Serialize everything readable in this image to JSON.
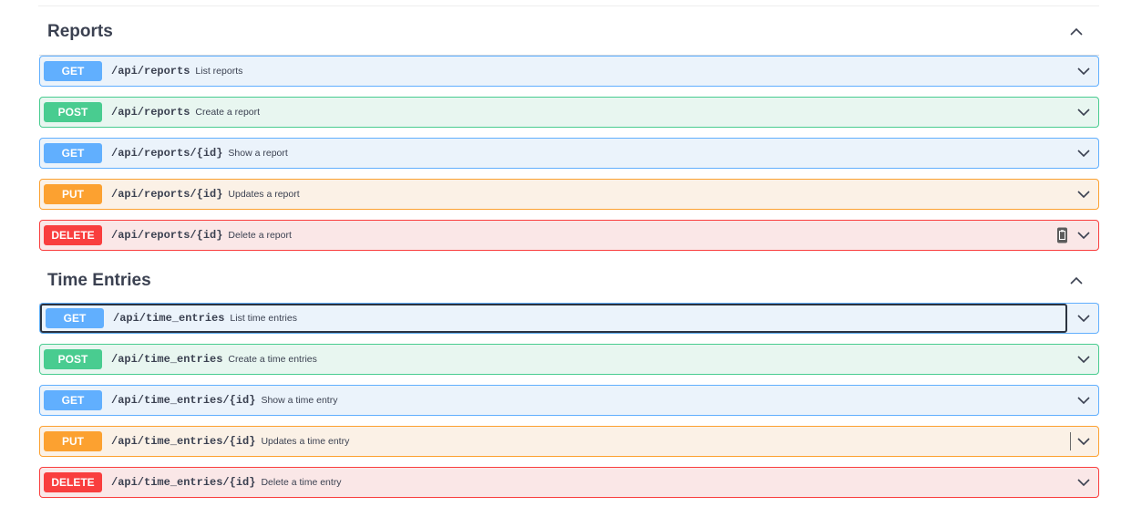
{
  "sections": [
    {
      "title": "Reports",
      "collapse_icon": "chevron-up-icon",
      "operations": [
        {
          "method": "GET",
          "path": "/api/reports",
          "summary": "List reports"
        },
        {
          "method": "POST",
          "path": "/api/reports",
          "summary": "Create a report"
        },
        {
          "method": "GET",
          "path": "/api/reports/{id}",
          "summary": "Show a report"
        },
        {
          "method": "PUT",
          "path": "/api/reports/{id}",
          "summary": "Updates a report"
        },
        {
          "method": "DELETE",
          "path": "/api/reports/{id}",
          "summary": "Delete a report"
        }
      ]
    },
    {
      "title": "Time Entries",
      "collapse_icon": "chevron-up-icon",
      "operations": [
        {
          "method": "GET",
          "path": "/api/time_entries",
          "summary": "List time entries"
        },
        {
          "method": "POST",
          "path": "/api/time_entries",
          "summary": "Create a time entries"
        },
        {
          "method": "GET",
          "path": "/api/time_entries/{id}",
          "summary": "Show a time entry"
        },
        {
          "method": "PUT",
          "path": "/api/time_entries/{id}",
          "summary": "Updates a time entry"
        },
        {
          "method": "DELETE",
          "path": "/api/time_entries/{id}",
          "summary": "Delete a time entry"
        }
      ]
    }
  ],
  "colors": {
    "get": "#61affe",
    "post": "#49cc90",
    "put": "#fca130",
    "delete": "#f93e3e",
    "text": "#3b4151"
  },
  "icons": {
    "expand": "chevron-down-icon",
    "copy": "copy-to-clipboard-icon"
  }
}
